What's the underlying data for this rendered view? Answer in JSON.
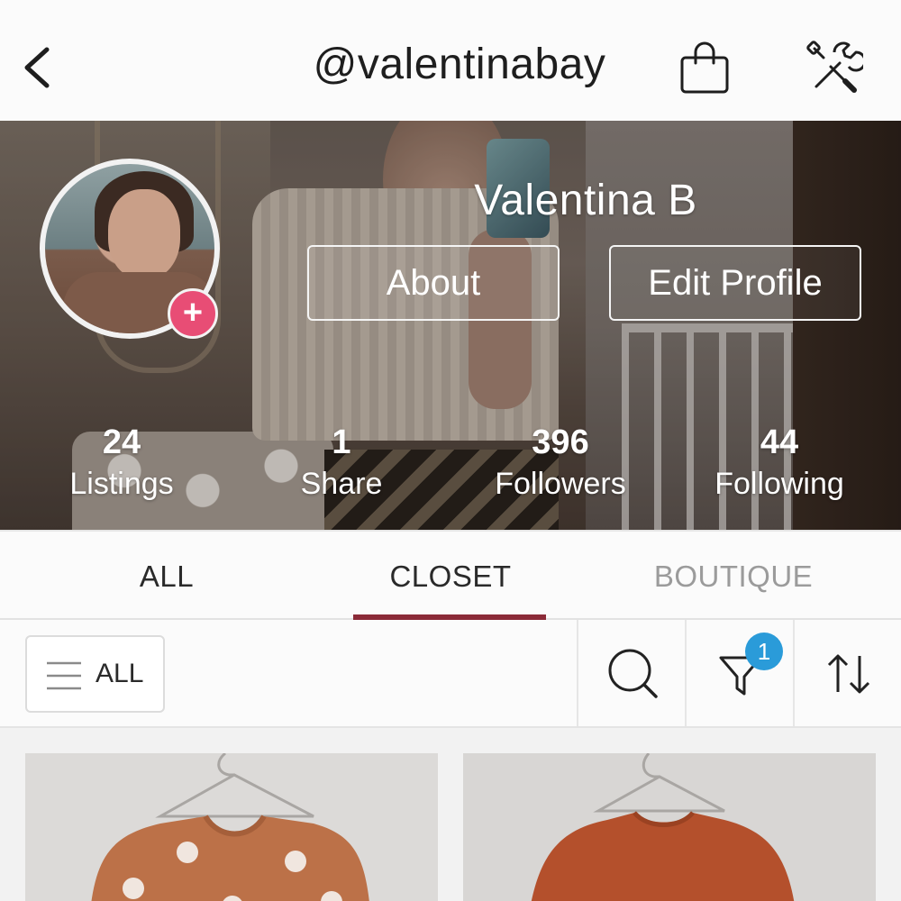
{
  "header": {
    "username": "@valentinabay",
    "back_icon": "chevron-left-icon",
    "bag_icon": "shopping-bag-icon",
    "tools_icon": "wrench-screwdriver-icon"
  },
  "profile": {
    "display_name": "Valentina B",
    "about_label": "About",
    "edit_profile_label": "Edit Profile",
    "add_photo_symbol": "+",
    "stats": [
      {
        "value": "24",
        "label": "Listings"
      },
      {
        "value": "1",
        "label": "Share"
      },
      {
        "value": "396",
        "label": "Followers"
      },
      {
        "value": "44",
        "label": "Following"
      }
    ]
  },
  "tabs": [
    {
      "label": "ALL",
      "active": false
    },
    {
      "label": "CLOSET",
      "active": true
    },
    {
      "label": "BOUTIQUE",
      "active": false
    }
  ],
  "toolbar": {
    "filter_label": "ALL",
    "filter_badge": "1",
    "search_icon": "search-icon",
    "funnel_icon": "funnel-icon",
    "sort_icon": "sort-arrows-icon"
  },
  "colors": {
    "accent": "#8b2a38",
    "add_button": "#e84d75",
    "badge": "#2a9bd9",
    "inactive_tab": "#9b9b9b"
  }
}
